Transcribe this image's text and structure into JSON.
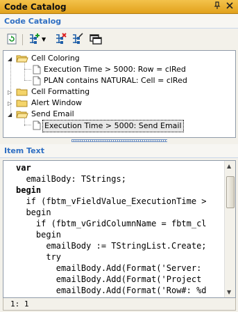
{
  "window": {
    "title": "Code Catalog"
  },
  "catalog_section": {
    "label": "Code Catalog"
  },
  "toolbar": {
    "buttons": [
      "refresh-icon",
      "add-item-icon",
      "delete-item-icon",
      "edit-item-icon",
      "window-icon"
    ]
  },
  "tree": {
    "items": [
      {
        "label": "Cell Coloring",
        "type": "folder",
        "expanded": true
      },
      {
        "label": "Execution Time > 5000: Row = clRed",
        "type": "document"
      },
      {
        "label": "PLAN contains NATURAL: Cell = clRed",
        "type": "document"
      },
      {
        "label": "Cell Formatting",
        "type": "folder",
        "expanded": false
      },
      {
        "label": "Alert Window",
        "type": "folder",
        "expanded": false
      },
      {
        "label": "Send Email",
        "type": "folder",
        "expanded": true
      },
      {
        "label": "Execution Time > 5000: Send Email",
        "type": "document",
        "selected": true
      }
    ]
  },
  "item_text_section": {
    "label": "Item Text"
  },
  "editor": {
    "lines": [
      "var",
      "  emailBody: TStrings;",
      "begin",
      "  if (fbtm_vFieldValue_ExecutionTime >",
      "  begin",
      "    if (fbtm_vGridColumnName = fbtm_cl",
      "    begin",
      "      emailBody := TStringList.Create;",
      "      try",
      "        emailBody.Add(Format('Server:",
      "        emailBody.Add(Format('Project",
      "        emailBody.Add(Format('Row#: %d"
    ],
    "cursor_position": "1: 1"
  },
  "colors": {
    "title_bar": "#e9ae2c",
    "section_label": "#2f6fc3"
  }
}
